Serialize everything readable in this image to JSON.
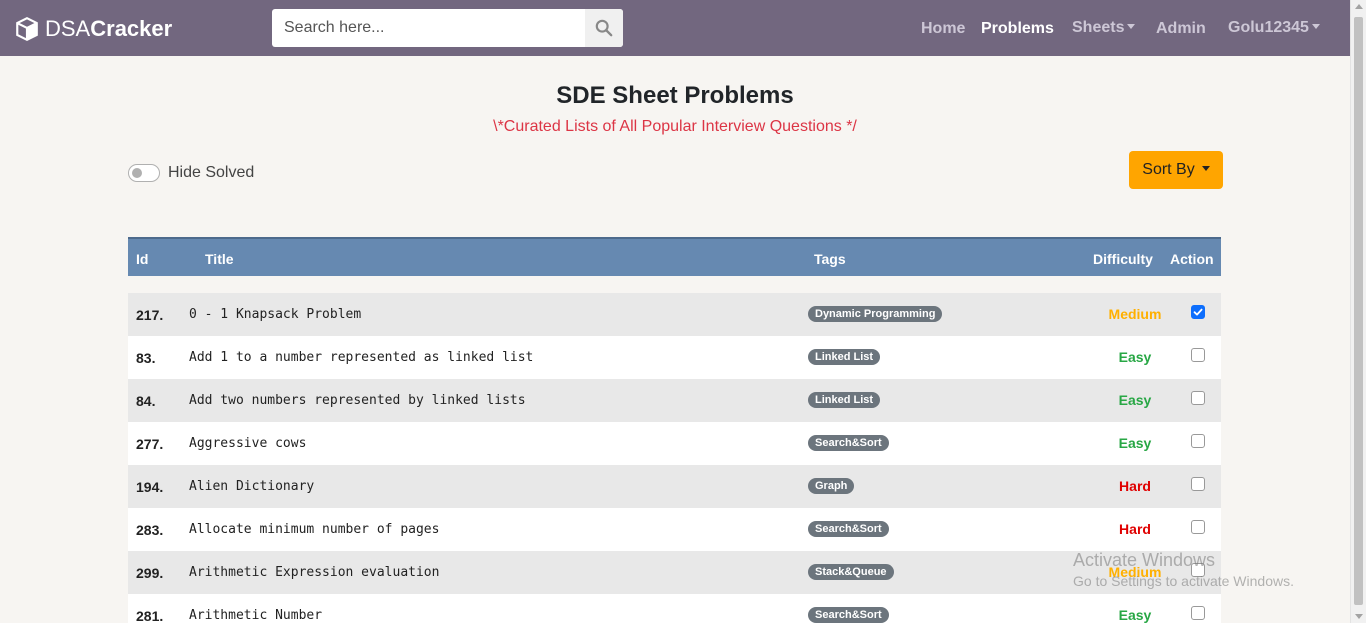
{
  "navbar": {
    "brand_prefix": "DSA",
    "brand_suffix": "Cracker",
    "search_placeholder": "Search here...",
    "items": [
      {
        "label": "Home",
        "active": false
      },
      {
        "label": "Problems",
        "active": true
      },
      {
        "label": "Sheets",
        "dropdown": true
      },
      {
        "label": "Admin",
        "active": false
      },
      {
        "label": "Golu12345",
        "dropdown": true
      }
    ]
  },
  "page": {
    "title": "SDE Sheet Problems",
    "subtitle": "\\*Curated Lists of All Popular Interview Questions */"
  },
  "controls": {
    "hide_solved_label": "Hide Solved",
    "hide_solved_on": false,
    "sort_label": "Sort By"
  },
  "table": {
    "columns": [
      "Id",
      "Title",
      "Tags",
      "Difficulty",
      "Action"
    ],
    "rows": [
      {
        "id": "217.",
        "title": "0 - 1 Knapsack Problem",
        "tag": "Dynamic Programming",
        "difficulty": "Medium",
        "checked": true
      },
      {
        "id": "83.",
        "title": "Add 1 to a number represented as linked list",
        "tag": "Linked List",
        "difficulty": "Easy",
        "checked": false
      },
      {
        "id": "84.",
        "title": "Add two numbers represented by linked lists",
        "tag": "Linked List",
        "difficulty": "Easy",
        "checked": false
      },
      {
        "id": "277.",
        "title": "Aggressive cows",
        "tag": "Search&Sort",
        "difficulty": "Easy",
        "checked": false
      },
      {
        "id": "194.",
        "title": "Alien Dictionary",
        "tag": "Graph",
        "difficulty": "Hard",
        "checked": false
      },
      {
        "id": "283.",
        "title": "Allocate minimum number of pages",
        "tag": "Search&Sort",
        "difficulty": "Hard",
        "checked": false
      },
      {
        "id": "299.",
        "title": "Arithmetic Expression evaluation",
        "tag": "Stack&Queue",
        "difficulty": "Medium",
        "checked": false
      },
      {
        "id": "281.",
        "title": "Arithmetic Number",
        "tag": "Search&Sort",
        "difficulty": "Easy",
        "checked": false
      }
    ]
  },
  "watermark": {
    "line1": "Activate Windows",
    "line2": "Go to Settings to activate Windows."
  },
  "colors": {
    "navbar": "#72677f",
    "table_header": "#6689b1",
    "sort_button": "#ffa500",
    "medium": "#ffb000",
    "easy": "#28a745",
    "hard": "#e00000"
  }
}
